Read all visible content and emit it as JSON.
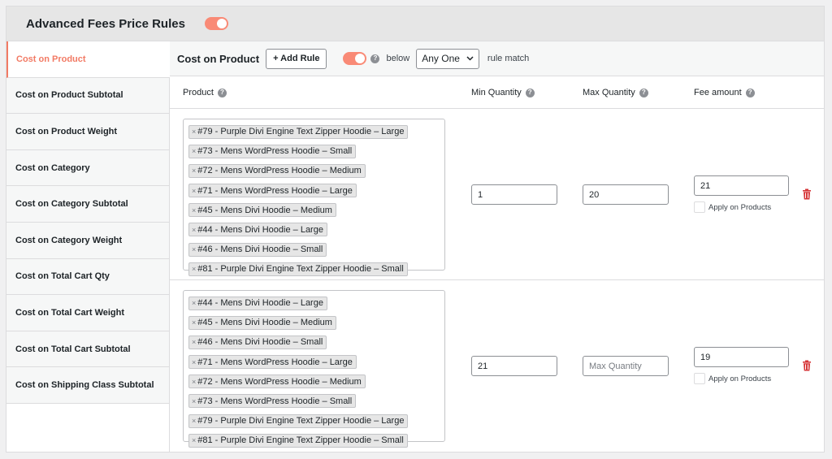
{
  "header": {
    "title": "Advanced Fees Price Rules"
  },
  "sidebar": {
    "items": [
      {
        "label": "Cost on Product"
      },
      {
        "label": "Cost on Product Subtotal"
      },
      {
        "label": "Cost on Product Weight"
      },
      {
        "label": "Cost on Category"
      },
      {
        "label": "Cost on Category Subtotal"
      },
      {
        "label": "Cost on Category Weight"
      },
      {
        "label": "Cost on Total Cart Qty"
      },
      {
        "label": "Cost on Total Cart Weight"
      },
      {
        "label": "Cost on Total Cart Subtotal"
      },
      {
        "label": "Cost on Shipping Class Subtotal"
      }
    ]
  },
  "toolbar": {
    "title": "Cost on Product",
    "add_rule_label": "+ Add Rule",
    "below_label": "below",
    "match_value": "Any One",
    "rule_match_label": "rule match"
  },
  "columns": {
    "product": "Product",
    "min_qty": "Min Quantity",
    "max_qty": "Max Quantity",
    "fee": "Fee amount"
  },
  "rules": [
    {
      "products": [
        "#79 - Purple Divi Engine Text Zipper Hoodie – Large",
        "#73 - Mens WordPress Hoodie – Small",
        "#72 - Mens WordPress Hoodie – Medium",
        "#71 - Mens WordPress Hoodie – Large",
        "#45 - Mens Divi Hoodie – Medium",
        "#44 - Mens Divi Hoodie – Large",
        "#46 - Mens Divi Hoodie – Small",
        "#81 - Purple Divi Engine Text Zipper Hoodie – Small"
      ],
      "min_qty": "1",
      "max_qty": "20",
      "max_qty_placeholder": "Max Quantity",
      "fee": "21",
      "apply_label": "Apply on Products"
    },
    {
      "products": [
        "#44 - Mens Divi Hoodie – Large",
        "#45 - Mens Divi Hoodie – Medium",
        "#46 - Mens Divi Hoodie – Small",
        "#71 - Mens WordPress Hoodie – Large",
        "#72 - Mens WordPress Hoodie – Medium",
        "#73 - Mens WordPress Hoodie – Small",
        "#79 - Purple Divi Engine Text Zipper Hoodie – Large",
        "#81 - Purple Divi Engine Text Zipper Hoodie – Small"
      ],
      "min_qty": "21",
      "max_qty": "",
      "max_qty_placeholder": "Max Quantity",
      "fee": "19",
      "apply_label": "Apply on Products"
    }
  ],
  "icons": {
    "help": "?",
    "tag_remove": "×",
    "select_chevron": "chevron-down-icon",
    "delete": "trash-icon"
  },
  "colors": {
    "accent": "#f27a64",
    "toggle_on": "#f98a76",
    "delete": "#d63638"
  }
}
